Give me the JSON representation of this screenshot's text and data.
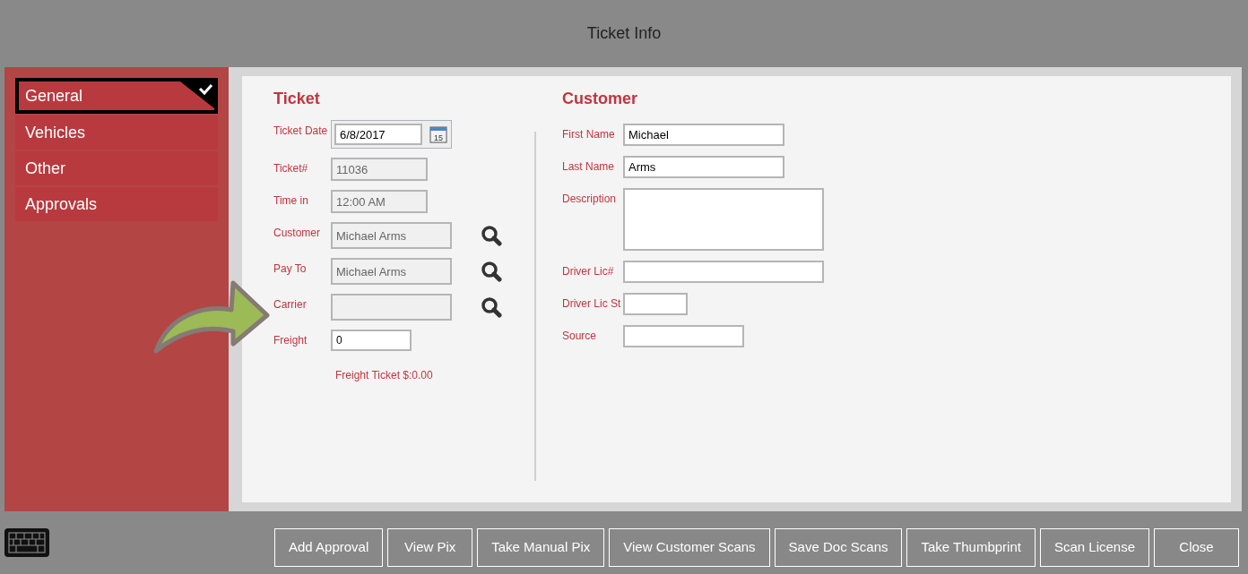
{
  "window": {
    "title": "Ticket Info"
  },
  "sidebar": {
    "items": [
      {
        "label": "General",
        "selected": true
      },
      {
        "label": "Vehicles",
        "selected": false
      },
      {
        "label": "Other",
        "selected": false
      },
      {
        "label": "Approvals",
        "selected": false
      }
    ]
  },
  "ticket": {
    "heading": "Ticket",
    "fields": [
      {
        "kind": "date",
        "label": "Ticket Date",
        "value": "6/8/2017",
        "calendar_day": "15"
      },
      {
        "kind": "readonly",
        "label": "Ticket#",
        "value": "11036"
      },
      {
        "kind": "readonly",
        "label": "Time in",
        "value": "12:00 AM"
      },
      {
        "kind": "lookup",
        "label": "Customer",
        "value": "Michael Arms"
      },
      {
        "kind": "lookup",
        "label": "Pay To",
        "value": "Michael Arms"
      },
      {
        "kind": "lookup",
        "label": "Carrier"
      },
      {
        "kind": "input",
        "label": "Freight",
        "value": "0"
      }
    ],
    "note": "Freight Ticket $:0.00"
  },
  "customer": {
    "heading": "Customer",
    "fields": [
      {
        "kind": "input",
        "label": "First Name",
        "value": "Michael"
      },
      {
        "kind": "input",
        "label": "Last Name",
        "value": "Arms"
      },
      {
        "kind": "textarea",
        "label": "Description"
      },
      {
        "kind": "wide",
        "label": "Driver Lic#"
      },
      {
        "kind": "short",
        "label": "Driver Lic St"
      },
      {
        "kind": "medium",
        "label": "Source"
      }
    ]
  },
  "buttons": [
    "Add Approval",
    "View Pix",
    "Take Manual Pix",
    "View Customer Scans",
    "Save Doc Scans",
    "Take Thumbprint",
    "Scan License",
    "Close"
  ]
}
